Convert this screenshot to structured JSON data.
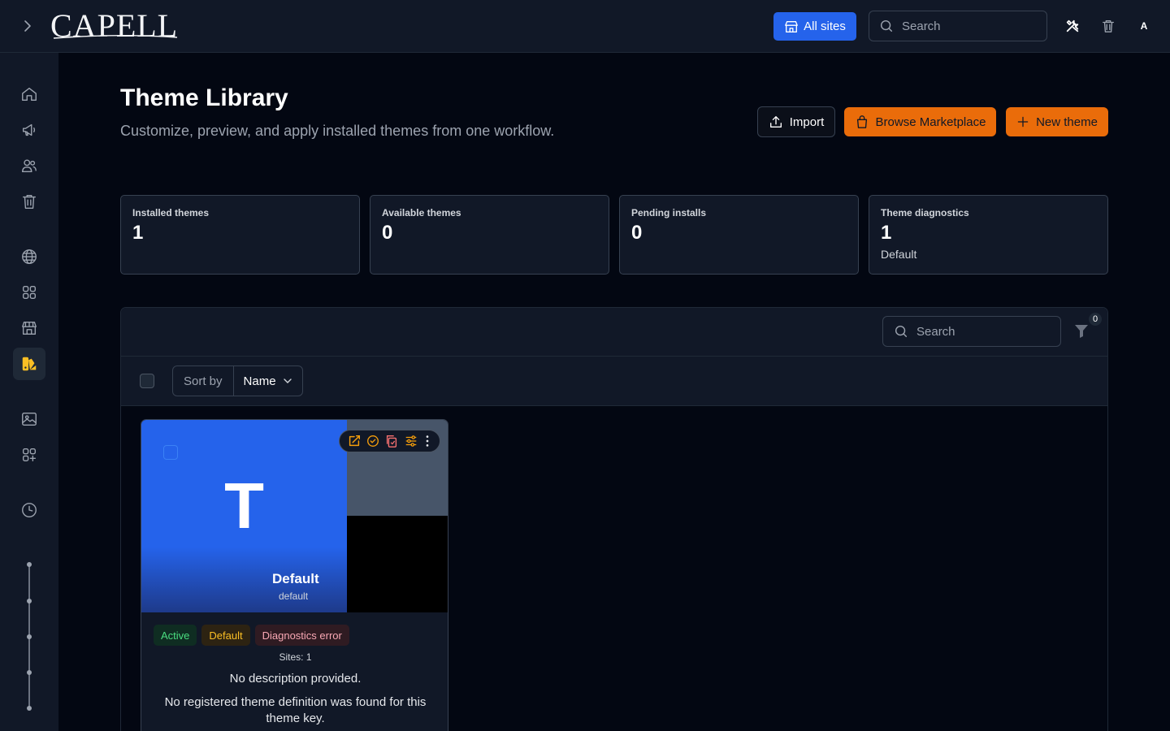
{
  "app": {
    "logo_text": "CAPELL"
  },
  "topbar": {
    "all_sites_label": "All sites",
    "search_placeholder": "Search",
    "avatar_initial": "A"
  },
  "sidebar": {
    "items": [
      {
        "icon": "home-icon"
      },
      {
        "icon": "megaphone-icon"
      },
      {
        "icon": "users-icon"
      },
      {
        "icon": "trash-icon"
      },
      {
        "icon": "globe-icon"
      },
      {
        "icon": "grid-icon"
      },
      {
        "icon": "storefront-icon"
      },
      {
        "icon": "themes-icon",
        "active": true
      },
      {
        "icon": "image-icon"
      },
      {
        "icon": "add-apps-icon"
      },
      {
        "icon": "clock-icon"
      }
    ]
  },
  "header": {
    "title": "Theme Library",
    "subtitle": "Customize, preview, and apply installed themes from one workflow.",
    "import_label": "Import",
    "marketplace_label": "Browse Marketplace",
    "new_theme_label": "New theme"
  },
  "stats": [
    {
      "label": "Installed themes",
      "value": "1",
      "note": ""
    },
    {
      "label": "Available themes",
      "value": "0",
      "note": ""
    },
    {
      "label": "Pending installs",
      "value": "0",
      "note": ""
    },
    {
      "label": "Theme diagnostics",
      "value": "1",
      "note": "Default"
    }
  ],
  "table": {
    "search_placeholder": "Search",
    "filter_count": "0",
    "sort_label": "Sort by",
    "sort_value": "Name"
  },
  "theme_card": {
    "letter": "T",
    "name": "Default",
    "key": "default",
    "badges": [
      "Active",
      "Default",
      "Diagnostics error"
    ],
    "sites": "Sites: 1",
    "description": "No description provided.",
    "error": "No registered theme definition was found for this theme key."
  },
  "colors": {
    "accent": "#ea6c0a",
    "primary": "#2563eb",
    "background": "#030712",
    "surface": "#111827"
  }
}
